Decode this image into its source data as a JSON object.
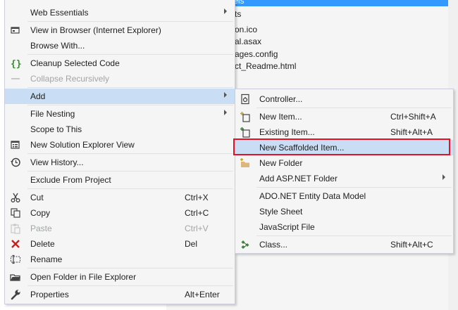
{
  "explorer": {
    "selected_fragment": "Models",
    "items": [
      "ts",
      "on.ico",
      "al.asax",
      "ages.config",
      "ct_Readme.html",
      "s"
    ]
  },
  "context_menu": [
    {
      "label": "Web Essentials",
      "submenu": true
    },
    {
      "separator": true
    },
    {
      "label": "View in Browser (Internet Explorer)",
      "icon": "browser-window-icon"
    },
    {
      "label": "Browse With..."
    },
    {
      "separator": true
    },
    {
      "label": "Cleanup Selected Code",
      "icon": "braces-icon"
    },
    {
      "label": "Collapse Recursively",
      "disabled": true,
      "icon": "collapse-icon"
    },
    {
      "separator": true
    },
    {
      "label": "Add",
      "submenu": true,
      "highlighted": true
    },
    {
      "separator": true
    },
    {
      "label": "File Nesting",
      "submenu": true
    },
    {
      "label": "Scope to This"
    },
    {
      "label": "New Solution Explorer View",
      "icon": "new-view-icon"
    },
    {
      "separator": true
    },
    {
      "label": "View History...",
      "icon": "history-icon"
    },
    {
      "separator": true
    },
    {
      "label": "Exclude From Project"
    },
    {
      "separator": true
    },
    {
      "label": "Cut",
      "shortcut": "Ctrl+X",
      "icon": "scissors-icon"
    },
    {
      "label": "Copy",
      "shortcut": "Ctrl+C",
      "icon": "copy-icon"
    },
    {
      "label": "Paste",
      "shortcut": "Ctrl+V",
      "disabled": true,
      "icon": "paste-icon"
    },
    {
      "label": "Delete",
      "shortcut": "Del",
      "icon": "delete-x-icon"
    },
    {
      "label": "Rename",
      "icon": "rename-icon"
    },
    {
      "separator": true
    },
    {
      "label": "Open Folder in File Explorer",
      "icon": "folder-open-icon"
    },
    {
      "separator": true
    },
    {
      "label": "Properties",
      "shortcut": "Alt+Enter",
      "icon": "wrench-icon"
    }
  ],
  "add_submenu": [
    {
      "label": "Controller...",
      "icon": "controller-icon"
    },
    {
      "separator": true
    },
    {
      "label": "New Item...",
      "shortcut": "Ctrl+Shift+A",
      "icon": "new-item-icon"
    },
    {
      "label": "Existing Item...",
      "shortcut": "Shift+Alt+A",
      "icon": "existing-item-icon"
    },
    {
      "label": "New Scaffolded Item...",
      "highlighted": true
    },
    {
      "label": "New Folder",
      "icon": "new-folder-icon"
    },
    {
      "label": "Add ASP.NET Folder",
      "submenu": true
    },
    {
      "separator": true
    },
    {
      "label": "ADO.NET Entity Data Model"
    },
    {
      "label": "Style Sheet"
    },
    {
      "label": "JavaScript File"
    },
    {
      "separator": true
    },
    {
      "label": "Class...",
      "shortcut": "Shift+Alt+C",
      "icon": "class-icon"
    }
  ],
  "colors": {
    "menu_bg": "#f5f5f5",
    "highlight": "#c9def5",
    "selection": "#3399ff",
    "callout_red": "#e81123"
  }
}
